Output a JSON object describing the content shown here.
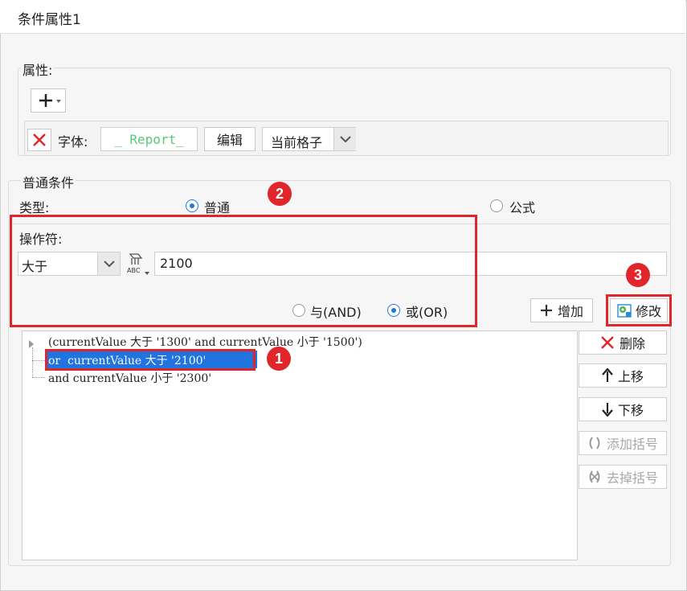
{
  "title": "条件属性1",
  "properties": {
    "legend": "属性:",
    "font_label": "字体:",
    "font_preview": "_ Report_",
    "edit_label": "编辑",
    "scope_value": "当前格子"
  },
  "condition": {
    "legend": "普通条件",
    "type_label": "类型:",
    "type_normal": "普通",
    "type_formula": "公式",
    "operator_label": "操作符:",
    "operator_value": "大于",
    "value": "2100",
    "and_label": "与(AND)",
    "or_label": "或(OR)",
    "add_label": "增加",
    "modify_label": "修改"
  },
  "tree": {
    "items": [
      "(currentValue 大于 '1300' and currentValue 小于 '1500')",
      "or  currentValue 大于 '2100'",
      "and currentValue 小于 '2300'"
    ]
  },
  "side_buttons": {
    "delete": "删除",
    "up": "上移",
    "down": "下移",
    "add_bracket": "添加括号",
    "remove_bracket": "去掉括号"
  },
  "badges": [
    "1",
    "2",
    "3"
  ],
  "colors": {
    "accent_blue": "#1f7ae0",
    "selection": "#1f74e0",
    "highlight_red": "#e0262b",
    "font_preview_green": "#5bc87a"
  }
}
